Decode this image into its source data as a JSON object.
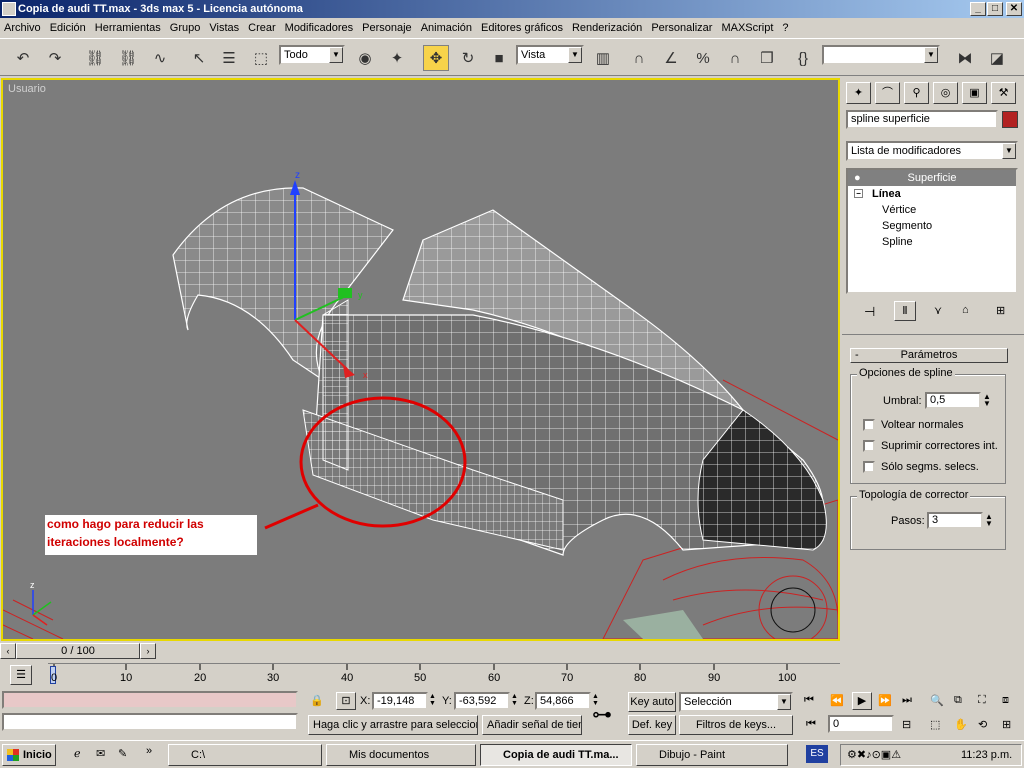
{
  "title": "Copia de audi TT.max - 3ds max 5 - Licencia autónoma",
  "window_controls": [
    "_",
    "□",
    "✕"
  ],
  "menu": [
    "Archivo",
    "Edición",
    "Herramientas",
    "Grupo",
    "Vistas",
    "Crear",
    "Modificadores",
    "Personaje",
    "Animación",
    "Editores gráficos",
    "Renderización",
    "Personalizar",
    "MAXScript",
    "?"
  ],
  "toolbar": {
    "selection_filter": "Todo",
    "reference_coord": "Vista",
    "named_selection": ""
  },
  "viewport": {
    "label": "Usuario",
    "annotation_line1": "como hago para reducir las",
    "annotation_line2": "iteraciones localmente?"
  },
  "command_panel": {
    "object_name": "spline superficie",
    "object_color": "#b22222",
    "modifier_list": "Lista de modificadores",
    "stack": {
      "top": "Superficie",
      "base": "Línea",
      "subs": [
        "Vértice",
        "Segmento",
        "Spline"
      ]
    },
    "rollout_title": "Parámetros",
    "spline_options": {
      "title": "Opciones de spline",
      "threshold_label": "Umbral:",
      "threshold_value": "0,5",
      "flip_normals": "Voltear normales",
      "remove_interior": "Suprimir correctores int.",
      "selected_only": "Sólo segms. selecs."
    },
    "patch_topology": {
      "title": "Topología de corrector",
      "steps_label": "Pasos:",
      "steps_value": "3"
    }
  },
  "timeline": {
    "frame_display": "0 / 100",
    "ticks": [
      "0",
      "10",
      "20",
      "30",
      "40",
      "50",
      "60",
      "70",
      "80",
      "90",
      "100"
    ]
  },
  "status": {
    "x_label": "X:",
    "x_value": "-19,148",
    "y_label": "Y:",
    "y_value": "-63,592",
    "z_label": "Z:",
    "z_value": "54,866",
    "prompt": "Haga clic y arrastre para seleccionar",
    "add_time_tag": "Añadir señal de tiempo",
    "key_auto": "Key auto",
    "set_key": "Def. key",
    "selection": "Selección",
    "key_filters": "Filtros de keys...",
    "current_frame": "0"
  },
  "taskbar": {
    "start": "Inicio",
    "tasks": [
      "C:\\",
      "Mis documentos",
      "Copia de audi TT.ma...",
      "Dibujo - Paint"
    ],
    "lang": "ES",
    "clock": "11:23 p.m."
  }
}
